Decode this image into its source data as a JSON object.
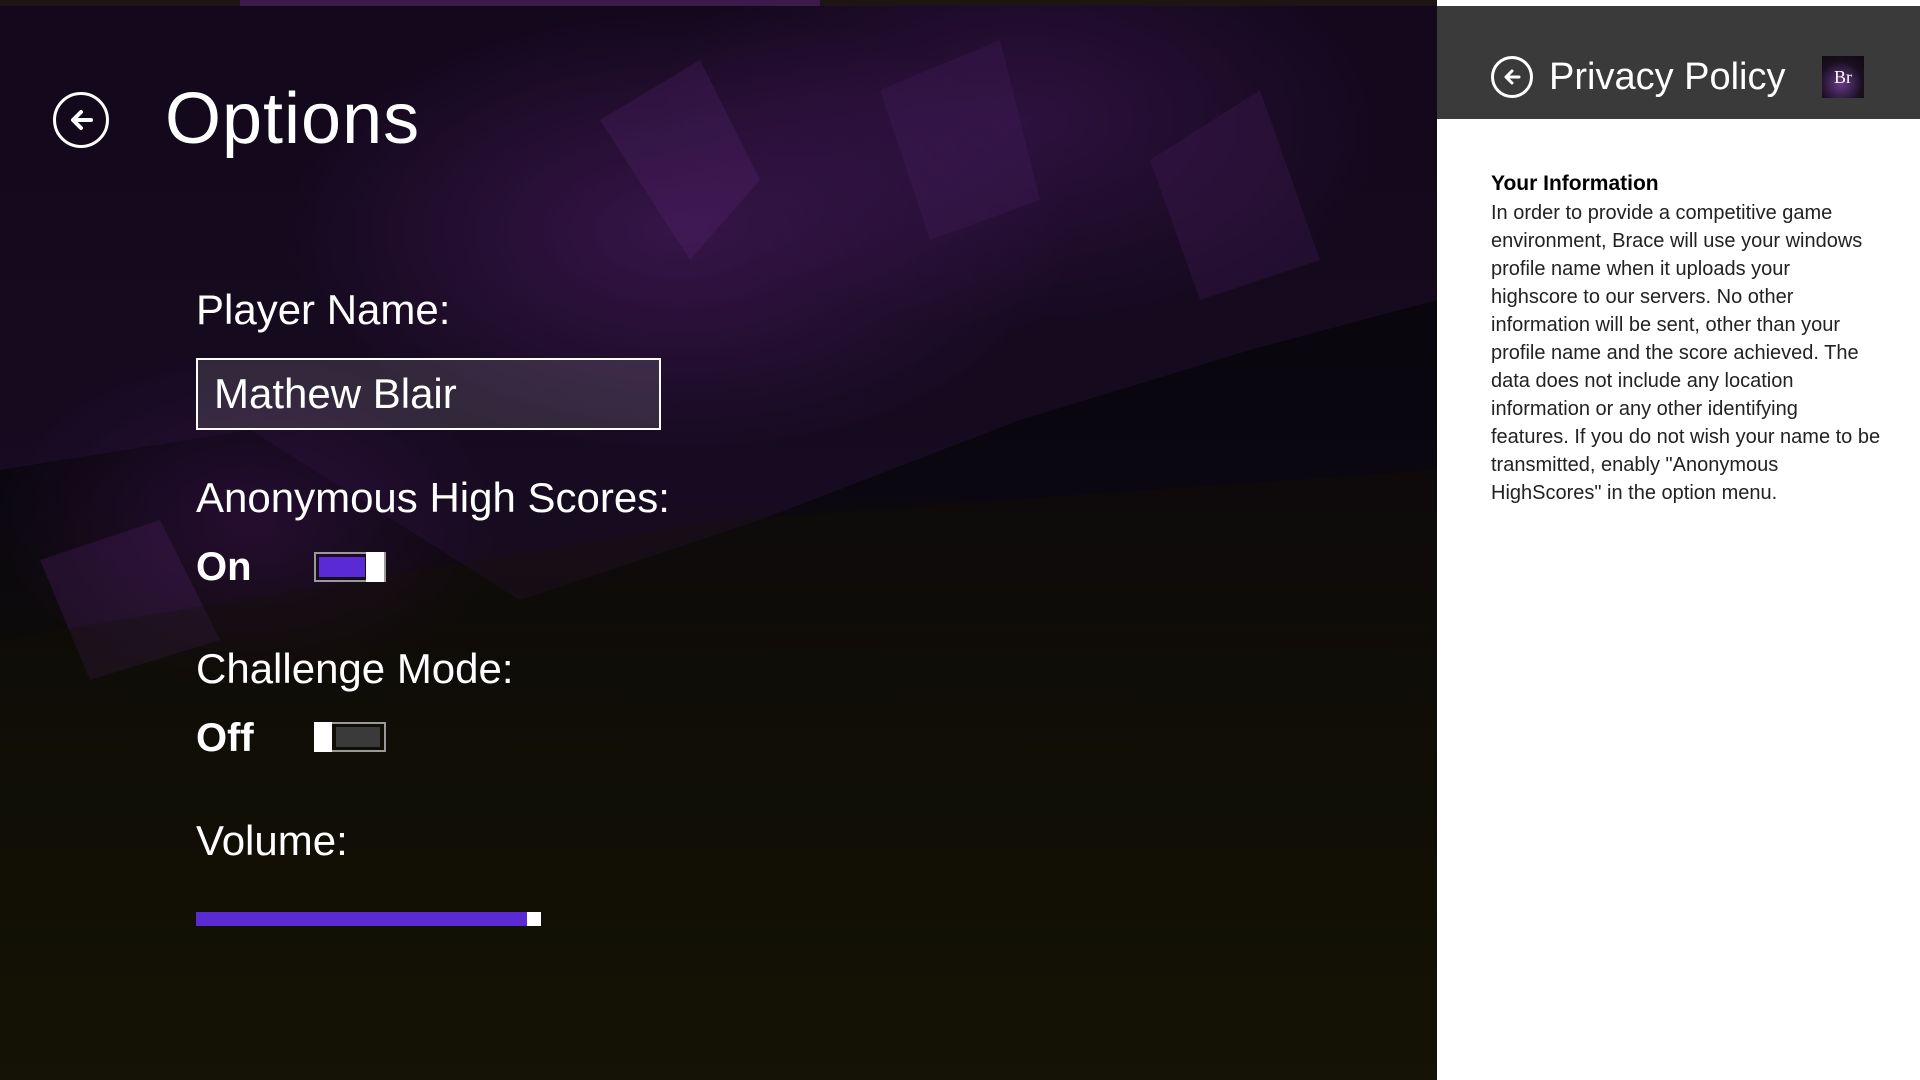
{
  "window": {
    "title": "Options"
  },
  "options": {
    "player_name_label": "Player Name:",
    "player_name_value": "Mathew Blair",
    "anonymous_label": "Anonymous High Scores:",
    "anonymous_state": "On",
    "anonymous_on": true,
    "challenge_label": "Challenge Mode:",
    "challenge_state": "Off",
    "challenge_on": false,
    "volume_label": "Volume:",
    "volume_level": 0.98
  },
  "flyout": {
    "title": "Privacy Policy",
    "app_logo_text": "Br",
    "section_heading": "Your Information",
    "section_body": "In order to provide a competitive game environment, Brace will use your windows profile name when it uploads your highscore to our servers. No other information will be sent, other than your profile name and the score achieved. The data does not include any location information or any other identifying features. If you do not wish your name to be transmitted, enably \"Anonymous HighScores\" in the option menu."
  },
  "icons": {
    "back": "back-arrow-icon",
    "flyout_back": "back-arrow-icon"
  },
  "colors": {
    "accent": "#5a2bd4",
    "toggle_off_fill": "#3a3a3a",
    "flyout_header": "#3a3a3a"
  }
}
